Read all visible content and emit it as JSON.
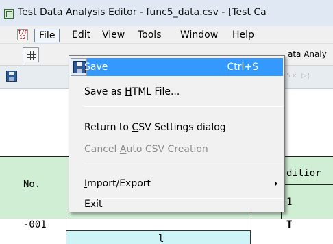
{
  "window": {
    "title": "Test Data Analysis Editor - func5_data.csv - [Test Ca"
  },
  "menubar": {
    "items": [
      "File",
      "Edit",
      "View",
      "Tools",
      "Window",
      "Help"
    ],
    "mdi_icon": "T/F 12"
  },
  "toolbar": {
    "tab_label": "ata Analy",
    "faded_controls": "5× ▷¦"
  },
  "file_menu": {
    "items": [
      {
        "label": "Save",
        "mnemonic": "S",
        "shortcut": "Ctrl+S",
        "icon": "save-icon",
        "highlighted": true,
        "enabled": true
      },
      {
        "label": "Save as HTML File...",
        "mnemonic": "H",
        "enabled": true
      },
      {
        "label": "Return to CSV Settings dialog",
        "mnemonic": "C",
        "enabled": true
      },
      {
        "label": "Cancel Auto CSV Creation",
        "mnemonic": "A",
        "enabled": false
      },
      {
        "label": "Import/Export",
        "mnemonic": "I",
        "submenu": true,
        "enabled": true
      },
      {
        "label": "Exit",
        "mnemonic": "x",
        "enabled": true
      }
    ]
  },
  "grid": {
    "header_no": "No.",
    "header_condition": "ditior",
    "header_condition_num": "1",
    "row_id": "-001",
    "row_value": "T",
    "selected_cell_fragment": "l"
  },
  "colors": {
    "highlight": "#3399ff",
    "grid_header": "#cfeed4",
    "selected_cell": "#cdf4f6"
  }
}
